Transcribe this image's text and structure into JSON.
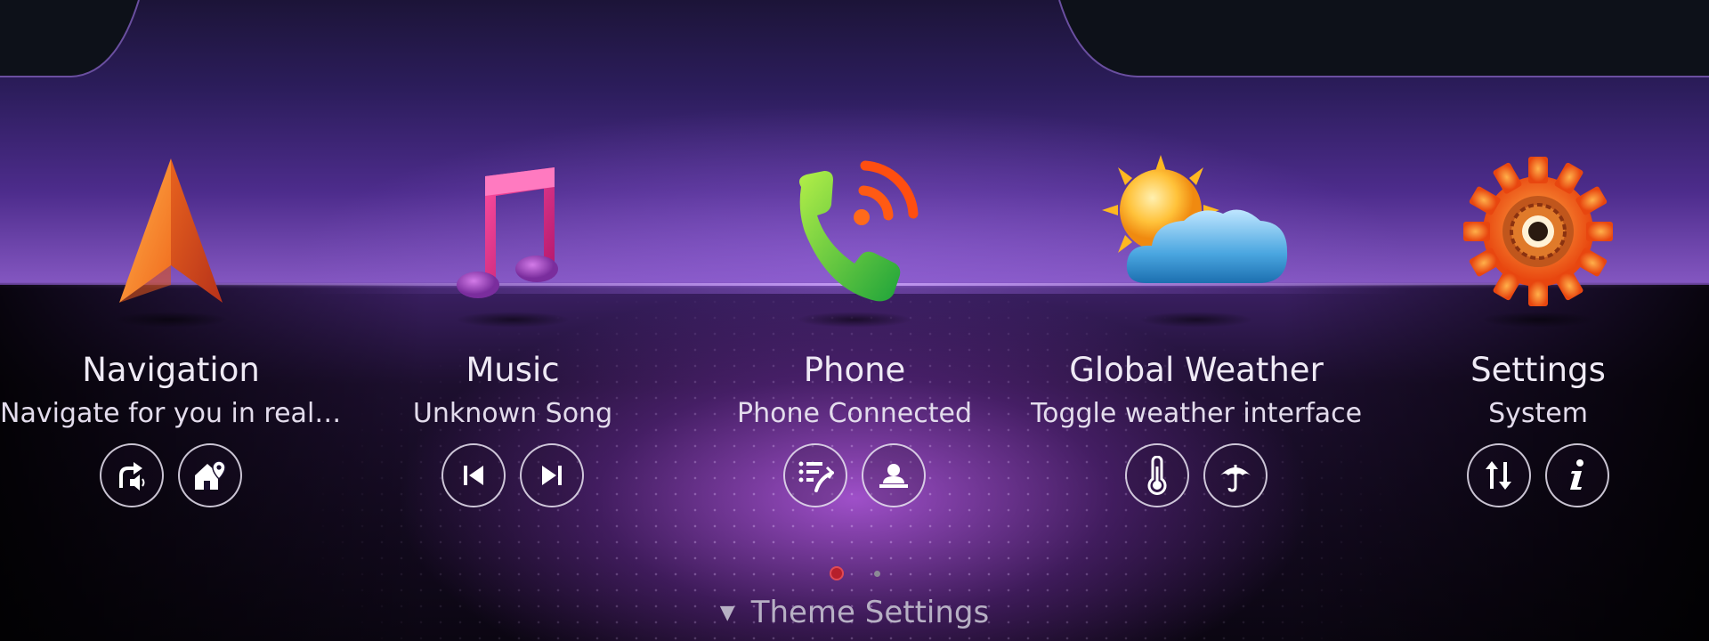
{
  "apps": [
    {
      "title": "Navigation",
      "subtitle": "Navigate for you in real time",
      "icon": "navigation-arrow-icon",
      "buttons": [
        {
          "name": "voice-guidance-button",
          "icon": "turn-voice-icon"
        },
        {
          "name": "home-location-button",
          "icon": "home-pin-icon"
        }
      ]
    },
    {
      "title": "Music",
      "subtitle": "Unknown Song",
      "icon": "music-note-icon",
      "buttons": [
        {
          "name": "previous-track-button",
          "icon": "skip-previous-icon"
        },
        {
          "name": "next-track-button",
          "icon": "skip-next-icon"
        }
      ]
    },
    {
      "title": "Phone",
      "subtitle": "Phone Connected",
      "icon": "phone-wireless-icon",
      "buttons": [
        {
          "name": "call-log-button",
          "icon": "call-log-icon"
        },
        {
          "name": "contacts-button",
          "icon": "contact-icon"
        }
      ]
    },
    {
      "title": "Global Weather",
      "subtitle": "Toggle weather interface",
      "icon": "sun-cloud-icon",
      "buttons": [
        {
          "name": "temperature-button",
          "icon": "thermometer-icon"
        },
        {
          "name": "umbrella-button",
          "icon": "umbrella-icon"
        }
      ]
    },
    {
      "title": "Settings",
      "subtitle": "System",
      "icon": "gear-icon",
      "buttons": [
        {
          "name": "sort-button",
          "icon": "up-down-arrows-icon"
        },
        {
          "name": "info-button",
          "icon": "info-icon"
        }
      ]
    }
  ],
  "pager": {
    "current": 1,
    "total": 2,
    "active_color": "#b61f2b"
  },
  "theme_settings": {
    "label": "Theme Settings",
    "arrow": "▼"
  }
}
